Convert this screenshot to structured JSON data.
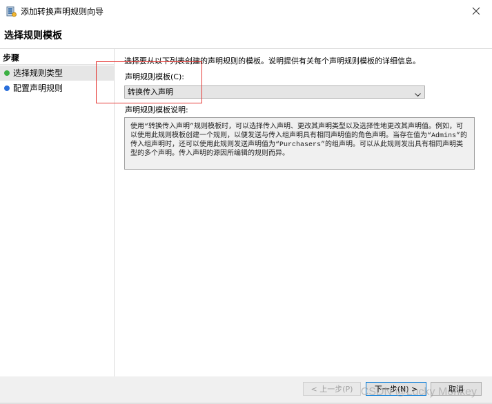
{
  "window": {
    "title": "添加转换声明规则向导",
    "icon": "server-wizard-icon",
    "close_icon": "close-icon"
  },
  "header": {
    "title": "选择规则模板"
  },
  "steps": {
    "heading": "步骤",
    "items": [
      {
        "label": "选择规则类型",
        "status_color": "#3cb043",
        "selected": true
      },
      {
        "label": "配置声明规则",
        "status_color": "#2a6fdb",
        "selected": false
      }
    ]
  },
  "main": {
    "intro": "选择要从以下列表创建的声明规则的模板。说明提供有关每个声明规则模板的详细信息。",
    "template_label": "声明规则模板(C):",
    "template_value": "转换传入声明",
    "description_label": "声明规则模板说明:",
    "description_text": "使用“转换传入声明”规则模板时，可以选择传入声明、更改其声明类型以及选择性地更改其声明值。例如，可以使用此规则模板创建一个规则，以便发送与传入组声明具有相同声明值的角色声明。当存在值为“Admins”的传入组声明时，还可以使用此规则发送声明值为“Purchasers”的组声明。可以从此规则发出具有相同声明类型的多个声明。传入声明的源因所编辑的规则而异。"
  },
  "footer": {
    "prev_label": "< 上一步(P)",
    "next_label": "下一步(N) >",
    "cancel_label": "取消"
  },
  "watermark": "CSDN @Lucky Monkey",
  "colors": {
    "highlight_box": "#e53935",
    "primary_button_border": "#0078d7"
  }
}
